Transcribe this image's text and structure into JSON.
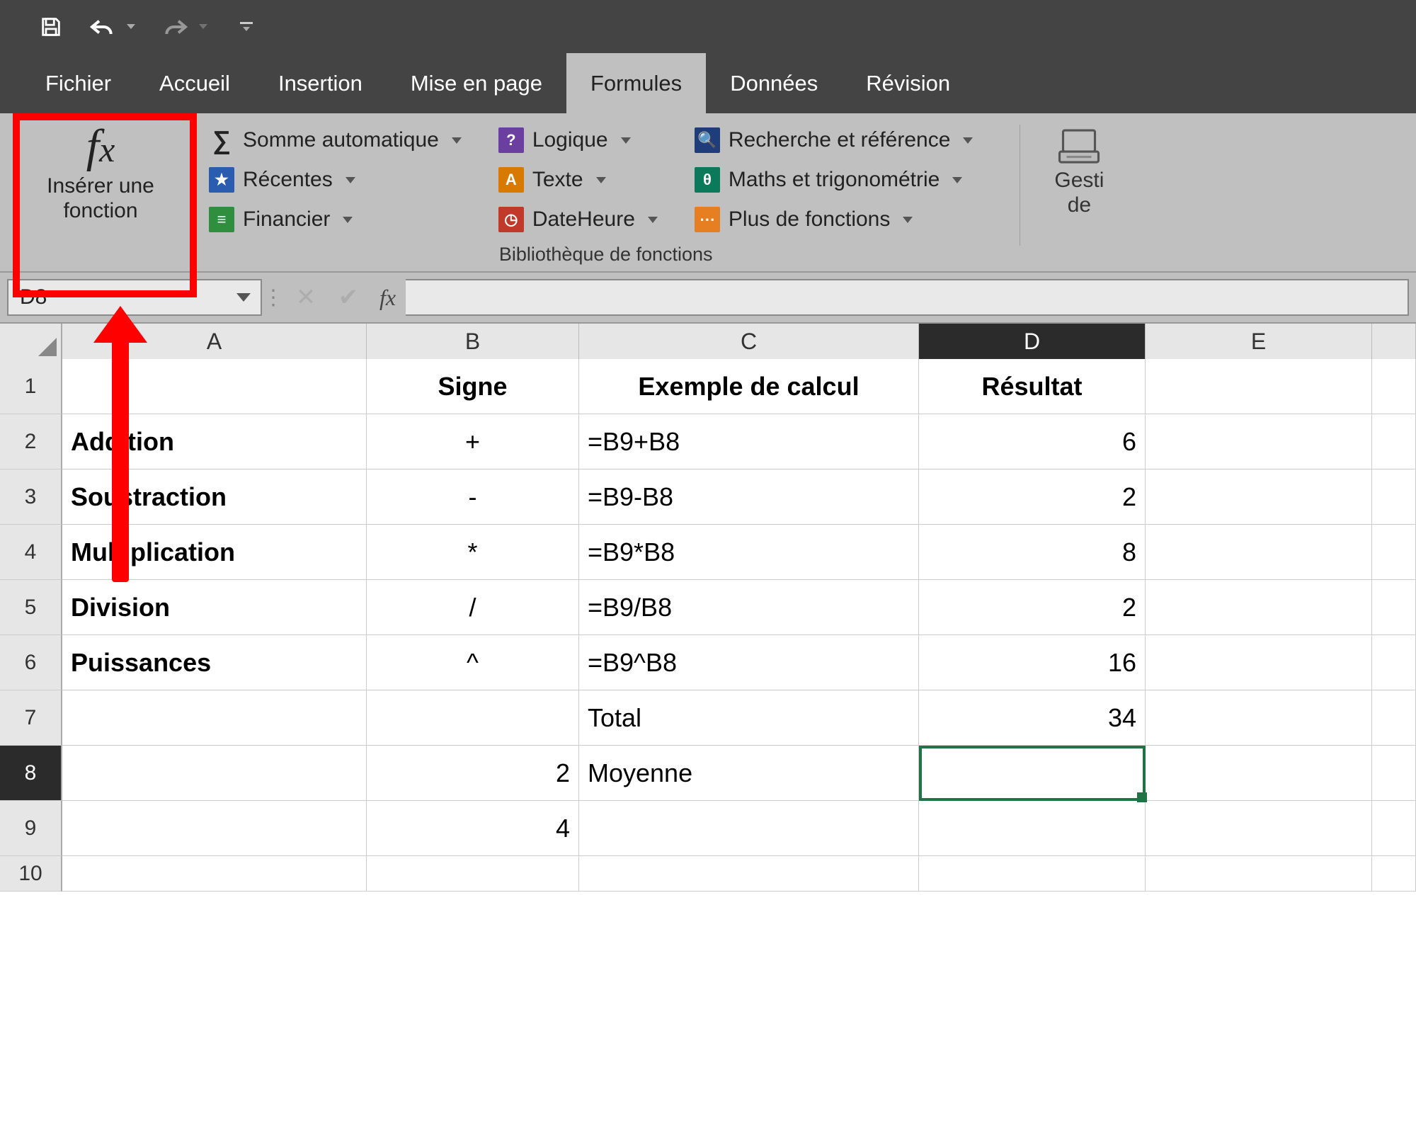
{
  "qat": {
    "save": "save",
    "undo": "undo",
    "redo": "redo",
    "customize": "customize"
  },
  "tabs": {
    "fichier": "Fichier",
    "accueil": "Accueil",
    "insertion": "Insertion",
    "mise_en_page": "Mise en page",
    "formules": "Formules",
    "donnees": "Données",
    "revision": "Révision"
  },
  "ribbon": {
    "insert_fn_line1": "Insérer une",
    "insert_fn_line2": "fonction",
    "autosum": "Somme automatique",
    "recent": "Récentes",
    "financial": "Financier",
    "logical": "Logique",
    "text": "Texte",
    "datetime": "DateHeure",
    "lookup": "Recherche et référence",
    "math": "Maths et trigonométrie",
    "more": "Plus de fonctions",
    "group_label": "Bibliothèque de fonctions",
    "names_line1": "Gesti",
    "names_line2": "de"
  },
  "formulabar": {
    "namebox": "D8",
    "fx": "fx"
  },
  "columns": [
    "A",
    "B",
    "C",
    "D",
    "E",
    ""
  ],
  "rows": [
    "1",
    "2",
    "3",
    "4",
    "5",
    "6",
    "7",
    "8",
    "9",
    "10"
  ],
  "cells": {
    "B1": "Signe",
    "C1": "Exemple de calcul",
    "D1": "Résultat",
    "A2": "Addition",
    "B2": "+",
    "C2": "=B9+B8",
    "D2": "6",
    "A3": "Soustraction",
    "B3": "-",
    "C3": "=B9-B8",
    "D3": "2",
    "A4": "Multiplication",
    "B4": "*",
    "C4": "=B9*B8",
    "D4": "8",
    "A5": "Division",
    "B5": "/",
    "C5": "=B9/B8",
    "D5": "2",
    "A6": "Puissances",
    "B6": "^",
    "C6": "=B9^B8",
    "D6": "16",
    "C7": "Total",
    "D7": "34",
    "B8": "2",
    "C8": "Moyenne",
    "B9": "4"
  },
  "active_cell": "D8"
}
